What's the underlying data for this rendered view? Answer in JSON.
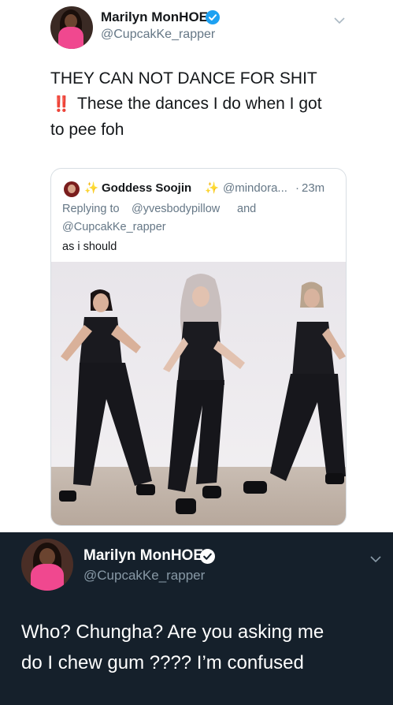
{
  "tweet1": {
    "name": "Marilyn MonHOE",
    "handle": "@CupcakKe_rapper",
    "line1": "THEY CAN NOT DANCE FOR SHIT",
    "line2_emoji": "‼️",
    "line2": "These the dances I do when I got",
    "line3": "to pee foh"
  },
  "quote": {
    "sparkle1": "✨",
    "name": "Goddess Soojin",
    "sparkle2": "✨",
    "handle": "@mindora...",
    "sep": "·",
    "time": "23m",
    "replying_prefix": "Replying to",
    "reply_user1": "@yvesbodypillow",
    "reply_and": "and",
    "reply_user2": "@CupcakKe_rapper",
    "text": "as i should"
  },
  "tweet2": {
    "name": "Marilyn MonHOE",
    "handle": "@CupcakKe_rapper",
    "line1": "Who? Chungha? Are you asking me",
    "line2": "do I chew gum ???? I’m confused"
  },
  "icons": {
    "avatar": "avatar-photo",
    "verified": "verified-badge-icon",
    "chevron": "chevron-down-icon",
    "quote_avatar": "avatar-photo"
  },
  "colors": {
    "verified_blue": "#1da1f2",
    "link_blue": "#1b95e0",
    "dark_bg": "#15202b",
    "gray_text": "#657786",
    "dark_gray_text": "#8899a6"
  }
}
